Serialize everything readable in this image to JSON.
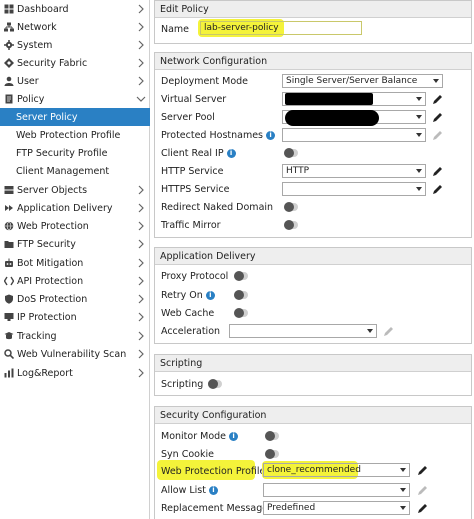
{
  "sidebar": {
    "items": [
      {
        "label": "Dashboard",
        "icon": "dashboard-icon"
      },
      {
        "label": "Network",
        "icon": "network-icon"
      },
      {
        "label": "System",
        "icon": "gear-icon"
      },
      {
        "label": "Security Fabric",
        "icon": "fabric-icon"
      },
      {
        "label": "User",
        "icon": "user-icon"
      },
      {
        "label": "Policy",
        "icon": "document-icon"
      },
      {
        "label": "Server Policy"
      },
      {
        "label": "Web Protection Profile"
      },
      {
        "label": "FTP Security Profile"
      },
      {
        "label": "Client Management"
      },
      {
        "label": "Server Objects",
        "icon": "server-icon"
      },
      {
        "label": "Application Delivery",
        "icon": "delivery-icon"
      },
      {
        "label": "Web Protection",
        "icon": "globe-icon"
      },
      {
        "label": "FTP Security",
        "icon": "folder-icon"
      },
      {
        "label": "Bot Mitigation",
        "icon": "bot-icon"
      },
      {
        "label": "API Protection",
        "icon": "api-icon"
      },
      {
        "label": "DoS Protection",
        "icon": "shield-icon"
      },
      {
        "label": "IP Protection",
        "icon": "ip-icon"
      },
      {
        "label": "Tracking",
        "icon": "tracking-icon"
      },
      {
        "label": "Web Vulnerability Scan",
        "icon": "scan-icon"
      },
      {
        "label": "Log&Report",
        "icon": "log-icon"
      }
    ]
  },
  "edit_policy": {
    "header": "Edit Policy",
    "name_label": "Name",
    "name_value": "lab-server-policy"
  },
  "network_config": {
    "header": "Network Configuration",
    "deployment_mode_label": "Deployment Mode",
    "deployment_mode_value": "Single Server/Server Balance",
    "virtual_server_label": "Virtual Server",
    "server_pool_label": "Server Pool",
    "protected_hostnames_label": "Protected Hostnames",
    "client_real_ip_label": "Client Real IP",
    "http_service_label": "HTTP Service",
    "http_service_value": "HTTP",
    "https_service_label": "HTTPS Service",
    "redirect_naked_label": "Redirect Naked Domain",
    "traffic_mirror_label": "Traffic Mirror"
  },
  "app_delivery": {
    "header": "Application Delivery",
    "proxy_protocol_label": "Proxy Protocol",
    "retry_on_label": "Retry On",
    "web_cache_label": "Web Cache",
    "acceleration_label": "Acceleration"
  },
  "scripting": {
    "header": "Scripting",
    "scripting_label": "Scripting"
  },
  "security_config": {
    "header": "Security Configuration",
    "monitor_mode_label": "Monitor Mode",
    "syn_cookie_label": "Syn Cookie",
    "wpp_label": "Web Protection Profile",
    "wpp_value": "clone_recommended",
    "allow_list_label": "Allow List",
    "replacement_message_label": "Replacement Message",
    "replacement_message_value": "Predefined"
  },
  "colors": {
    "accent": "#2a80c4",
    "highlight": "#f4f33a"
  }
}
